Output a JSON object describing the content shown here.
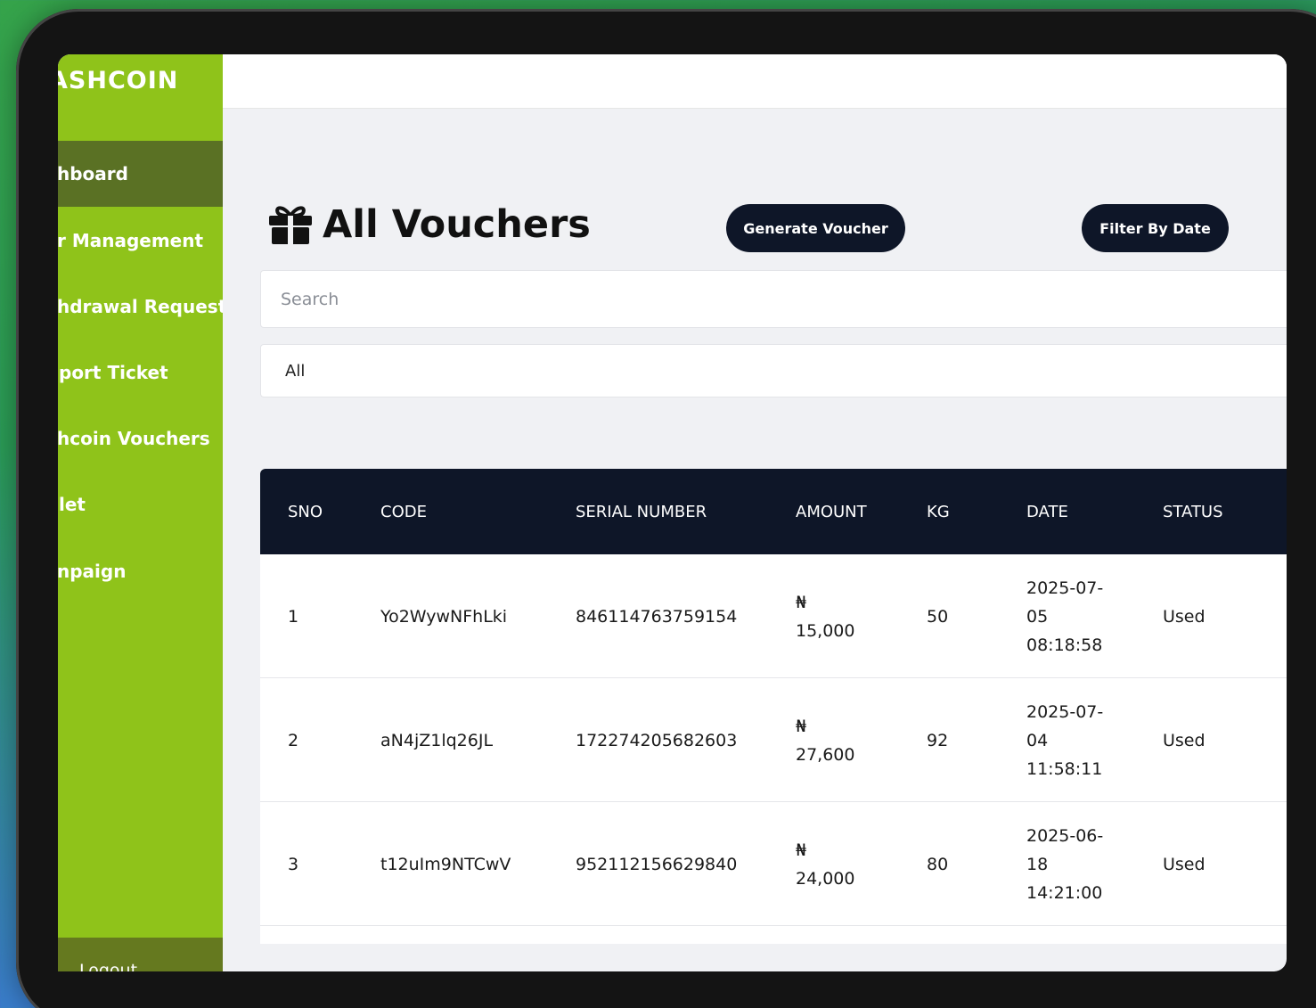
{
  "brand": "ASHCOIN",
  "sidebar": {
    "items": [
      {
        "label": "hboard",
        "active": true
      },
      {
        "label": "r Management"
      },
      {
        "label": "hdrawal Request"
      },
      {
        "label": "port Ticket"
      },
      {
        "label": "hcoin Vouchers"
      },
      {
        "label": "let"
      },
      {
        "label": "npaign"
      }
    ],
    "logout": "Logout"
  },
  "page": {
    "title": "All Vouchers",
    "title_icon": "gift-icon",
    "generate_label": "Generate Voucher",
    "filter_label": "Filter By Date",
    "search_placeholder": "Search",
    "status_filter": "All"
  },
  "table": {
    "headers": [
      "SNO",
      "CODE",
      "SERIAL NUMBER",
      "AMOUNT",
      "KG",
      "DATE",
      "STATUS"
    ],
    "rows": [
      {
        "sno": "1",
        "code": "Yo2WywNFhLki",
        "serial": "846114763759154",
        "currency": "₦",
        "amount": "15,000",
        "kg": "50",
        "date1": "2025-07-",
        "date2": "05",
        "date3": "08:18:58",
        "status": "Used"
      },
      {
        "sno": "2",
        "code": "aN4jZ1lq26JL",
        "serial": "172274205682603",
        "currency": "₦",
        "amount": "27,600",
        "kg": "92",
        "date1": "2025-07-",
        "date2": "04",
        "date3": "11:58:11",
        "status": "Used"
      },
      {
        "sno": "3",
        "code": "t12uIm9NTCwV",
        "serial": "952112156629840",
        "currency": "₦",
        "amount": "24,000",
        "kg": "80",
        "date1": "2025-06-",
        "date2": "18",
        "date3": "14:21:00",
        "status": "Used"
      }
    ]
  },
  "colors": {
    "sidebar": "#8fc31a",
    "sidebar_active": "#5a7124",
    "navy": "#0e1628"
  }
}
